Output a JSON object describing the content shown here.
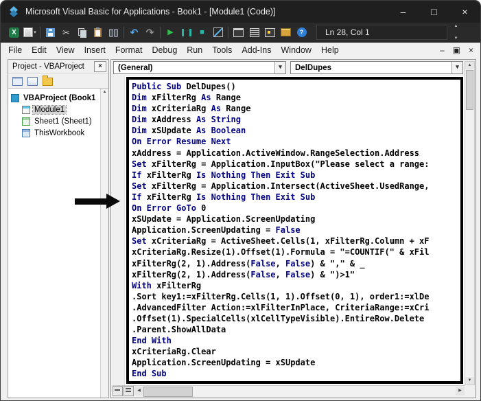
{
  "window": {
    "title": "Microsoft Visual Basic for Applications - Book1 - [Module1 (Code)]",
    "controls": {
      "minimize": "–",
      "maximize": "□",
      "close": "×"
    }
  },
  "toolbar": {
    "line_col": "Ln 28, Col 1"
  },
  "menubar": {
    "items": [
      "File",
      "Edit",
      "View",
      "Insert",
      "Format",
      "Debug",
      "Run",
      "Tools",
      "Add-Ins",
      "Window",
      "Help"
    ],
    "child_controls": {
      "minimize": "–",
      "restore": "▣",
      "close": "×"
    }
  },
  "project_panel": {
    "title": "Project - VBAProject",
    "tree": [
      {
        "label": "VBAProject (Book1",
        "icon": "project",
        "level": 0,
        "bold": true,
        "selected": false
      },
      {
        "label": "Module1",
        "icon": "module",
        "level": 1,
        "bold": false,
        "selected": true
      },
      {
        "label": "Sheet1 (Sheet1)",
        "icon": "sheet",
        "level": 1,
        "bold": false,
        "selected": false
      },
      {
        "label": "ThisWorkbook",
        "icon": "workbook",
        "level": 1,
        "bold": false,
        "selected": false
      }
    ]
  },
  "code_window": {
    "object_dropdown": "(General)",
    "procedure_dropdown": "DelDupes",
    "lines": [
      [
        {
          "t": "Public Sub ",
          "k": true
        },
        {
          "t": "DelDupes()"
        }
      ],
      [
        {
          "t": "Dim ",
          "k": true
        },
        {
          "t": "xFilterRg "
        },
        {
          "t": "As ",
          "k": true
        },
        {
          "t": "Range"
        }
      ],
      [
        {
          "t": "Dim ",
          "k": true
        },
        {
          "t": "xCriteriaRg "
        },
        {
          "t": "As ",
          "k": true
        },
        {
          "t": "Range"
        }
      ],
      [
        {
          "t": "Dim ",
          "k": true
        },
        {
          "t": "xAddress "
        },
        {
          "t": "As String",
          "k": true
        }
      ],
      [
        {
          "t": "Dim ",
          "k": true
        },
        {
          "t": "xSUpdate "
        },
        {
          "t": "As Boolean",
          "k": true
        }
      ],
      [
        {
          "t": "On Error Resume Next",
          "k": true
        }
      ],
      [
        {
          "t": "xAddress = Application.ActiveWindow.RangeSelection.Address"
        }
      ],
      [
        {
          "t": "Set ",
          "k": true
        },
        {
          "t": "xFilterRg = Application.InputBox(\"Please select a range:"
        }
      ],
      [
        {
          "t": "If ",
          "k": true
        },
        {
          "t": "xFilterRg "
        },
        {
          "t": "Is Nothing Then Exit Sub",
          "k": true
        }
      ],
      [
        {
          "t": "Set ",
          "k": true
        },
        {
          "t": "xFilterRg = Application.Intersect(ActiveSheet.UsedRange,"
        }
      ],
      [
        {
          "t": "If ",
          "k": true
        },
        {
          "t": "xFilterRg "
        },
        {
          "t": "Is Nothing Then Exit Sub",
          "k": true
        }
      ],
      [
        {
          "t": "On Error GoTo ",
          "k": true
        },
        {
          "t": "0"
        }
      ],
      [
        {
          "t": "xSUpdate = Application.ScreenUpdating"
        }
      ],
      [
        {
          "t": "Application.ScreenUpdating = "
        },
        {
          "t": "False",
          "k": true
        }
      ],
      [
        {
          "t": "Set ",
          "k": true
        },
        {
          "t": "xCriteriaRg = ActiveSheet.Cells(1, xFilterRg.Column + xF"
        }
      ],
      [
        {
          "t": "xCriteriaRg.Resize(1).Offset(1).Formula = \"=COUNTIF(\" & xFil"
        }
      ],
      [
        {
          "t": "xFilterRg(2, 1).Address("
        },
        {
          "t": "False",
          "k": true
        },
        {
          "t": ", "
        },
        {
          "t": "False",
          "k": true
        },
        {
          "t": ") & \",\" & _"
        }
      ],
      [
        {
          "t": "xFilterRg(2, 1).Address("
        },
        {
          "t": "False",
          "k": true
        },
        {
          "t": ", "
        },
        {
          "t": "False",
          "k": true
        },
        {
          "t": ") & \")>1\""
        }
      ],
      [
        {
          "t": "With ",
          "k": true
        },
        {
          "t": "xFilterRg"
        }
      ],
      [
        {
          "t": ".Sort key1:=xFilterRg.Cells(1, 1).Offset(0, 1), order1:=xlDe"
        }
      ],
      [
        {
          "t": ".AdvancedFilter Action:=xlFilterInPlace, CriteriaRange:=xCri"
        }
      ],
      [
        {
          "t": ".Offset(1).SpecialCells(xlCellTypeVisible).EntireRow.Delete"
        }
      ],
      [
        {
          "t": ".Parent.ShowAllData"
        }
      ],
      [
        {
          "t": "End With",
          "k": true
        }
      ],
      [
        {
          "t": "xCriteriaRg.Clear"
        }
      ],
      [
        {
          "t": "Application.ScreenUpdating = xSUpdate"
        }
      ],
      [
        {
          "t": "End Sub",
          "k": true
        }
      ]
    ]
  },
  "colors": {
    "keyword": "#000080",
    "annotation": "#000000",
    "selection_bg": "#d4d4d4",
    "titlebar_bg": "#1f1f1f",
    "toolbar_bg": "#2a2a2a",
    "run_green": "#35c14e"
  }
}
